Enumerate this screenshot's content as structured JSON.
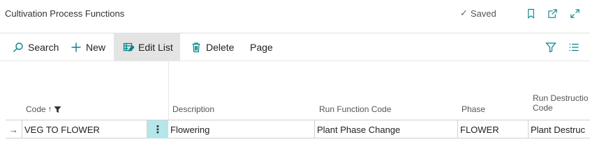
{
  "header": {
    "title": "Cultivation Process Functions",
    "status": "Saved",
    "icons": [
      "checkmark-icon",
      "bookmark-icon",
      "open-new-window-icon",
      "expand-icon"
    ]
  },
  "actions": {
    "search_label": "Search",
    "new_label": "New",
    "edit_list_label": "Edit List",
    "delete_label": "Delete",
    "page_label": "Page",
    "right_icons": [
      "filter-icon",
      "list-view-icon"
    ]
  },
  "table": {
    "columns": {
      "code": "Code",
      "description": "Description",
      "run_function_code": "Run Function Code",
      "phase": "Phase",
      "run_destruction_line1": "Run Destructio",
      "run_destruction_line2": "Code"
    },
    "sort_indicator": "↑",
    "rows": [
      {
        "code": "VEG TO FLOWER",
        "description": "Flowering",
        "run_function_code": "Plant Phase Change",
        "phase": "FLOWER",
        "run_destruction_code": "Plant Destruc"
      }
    ]
  },
  "colors": {
    "accent": "#008489",
    "selected_cell": "#b4e6ea",
    "active_action_bg": "#e4e4e4"
  }
}
